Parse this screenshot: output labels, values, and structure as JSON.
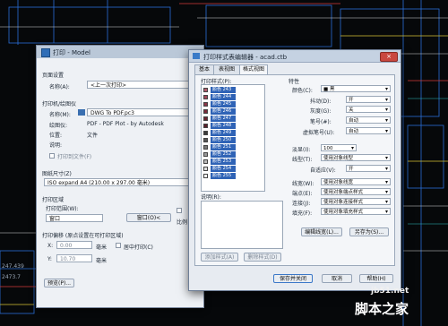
{
  "background": {
    "coords": [
      "247.439",
      "2473.7"
    ]
  },
  "plot_dialog": {
    "title": "打印 - Model",
    "page_setup_section": "页面设置",
    "name_label": "名称(A):",
    "name_value": "<上一次打印>",
    "printer_section": "打印机/绘图仪",
    "printer_name_label": "名称(M):",
    "printer_name_value": "DWG To PDF.pc3",
    "plotter_label": "绘图仪:",
    "plotter_value": "PDF - PDF Plot - by Autodesk",
    "location_label": "位置:",
    "location_value": "文件",
    "desc_label": "说明:",
    "print_to_file_label": "打印到文件(F)",
    "paper_size_section": "图纸尺寸(Z)",
    "paper_size_value": "ISO expand A4 (210.00 x 297.00 毫米)",
    "plot_area_section": "打印区域",
    "plot_range_label": "打印范围(W):",
    "plot_range_value": "窗口",
    "window_button": "窗口(O)<",
    "plot_offset_section": "打印偏移 (原点设置在可打印区域)",
    "x_label": "X:",
    "x_value": "0.00",
    "x_unit": "毫米",
    "center_label": "居中打印(C)",
    "y_label": "Y:",
    "y_value": "10.70",
    "y_unit": "毫米",
    "scale_label": "比例",
    "preview_button": "预览(P)..."
  },
  "editor": {
    "title": "打印样式表编辑器 - acad.ctb",
    "close_label": "×",
    "tabs": [
      {
        "label": "基本"
      },
      {
        "label": "表视图"
      },
      {
        "label": "格式视图"
      }
    ],
    "styles_label": "打印样式(P):",
    "styles": [
      {
        "name": "颜色 243",
        "color": "#b05a6a"
      },
      {
        "name": "颜色 244",
        "color": "#a04658"
      },
      {
        "name": "颜色 245",
        "color": "#8a3648"
      },
      {
        "name": "颜色 246",
        "color": "#7a2a3a"
      },
      {
        "name": "颜色 247",
        "color": "#6a2230"
      },
      {
        "name": "颜色 248",
        "color": "#58202a"
      },
      {
        "name": "颜色 249",
        "color": "#3a3a3a"
      },
      {
        "name": "颜色 250",
        "color": "#555555"
      },
      {
        "name": "颜色 251",
        "color": "#777777"
      },
      {
        "name": "颜色 252",
        "color": "#999999"
      },
      {
        "name": "颜色 253",
        "color": "#bbbbbb"
      },
      {
        "name": "颜色 254",
        "color": "#dddddd"
      },
      {
        "name": "颜色 255",
        "color": "#ffffff"
      }
    ],
    "desc_label": "说明(R):",
    "add_style_button": "添加样式(A)",
    "delete_style_button": "删除样式(D)",
    "properties_label": "特性",
    "props": {
      "color_label": "颜色(C):",
      "color_value": "■ 黑",
      "dither_label": "抖动(D):",
      "dither_value": "开",
      "gray_label": "灰度(G):",
      "gray_value": "关",
      "pen_label": "笔号(#):",
      "pen_value": "自动",
      "vpen_label": "虚拟笔号(U):",
      "vpen_value": "自动",
      "screen_label": "淡显(I):",
      "screen_value": "100",
      "linetype_label": "线型(T):",
      "linetype_value": "使用对象线型",
      "adaptive_label": "自适应(V):",
      "adaptive_value": "开",
      "lineweight_label": "线宽(W):",
      "lineweight_value": "使用对象线宽",
      "endstyle_label": "端点(E):",
      "endstyle_value": "使用对象端点样式",
      "joinstyle_label": "连接(J):",
      "joinstyle_value": "使用对象连接样式",
      "fill_label": "填充(F):",
      "fill_value": "使用对象填充样式"
    },
    "edit_lineweights_button": "编辑线宽(L)...",
    "save_as_button": "另存为(S)...",
    "save_close_button": "保存并关闭",
    "cancel_button": "取消",
    "help_button": "帮助(H)"
  },
  "watermark": {
    "site": "jb51.net",
    "brand": "脚本之家"
  }
}
